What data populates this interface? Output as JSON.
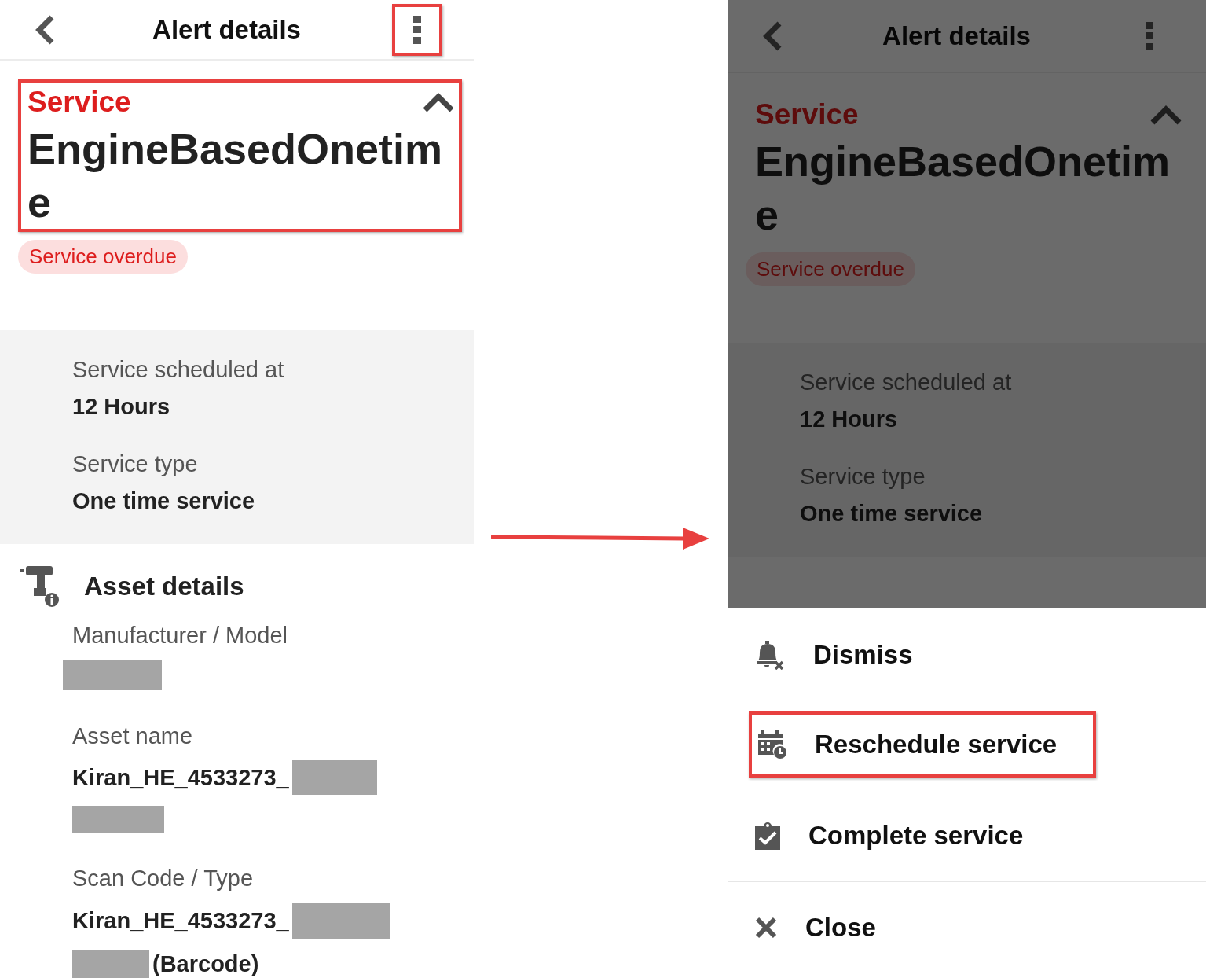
{
  "screens": [
    {
      "dimmed": false,
      "header": {
        "title": "Alert details",
        "menu_highlighted": true
      },
      "alert": {
        "highlighted": true,
        "category": "Service",
        "name": "EngineBasedOnetime",
        "badge": "Service overdue"
      },
      "details": [
        {
          "label": "Service scheduled at",
          "value": "12 Hours"
        },
        {
          "label": "Service type",
          "value": "One time service"
        }
      ],
      "asset": {
        "title": "Asset details",
        "fields": [
          {
            "label": "Manufacturer / Model",
            "redacted": true
          },
          {
            "label": "Asset name",
            "value": "Kiran_HE_4533273_",
            "redacted": true
          },
          {
            "label": "Scan Code / Type",
            "value": "Kiran_HE_4533273_",
            "redacted": true,
            "suffix": "(Barcode)"
          }
        ]
      }
    },
    {
      "dimmed": true,
      "header": {
        "title": "Alert details",
        "menu_highlighted": false
      },
      "alert": {
        "highlighted": false,
        "category": "Service",
        "name": "EngineBasedOnetime",
        "badge": "Service overdue"
      },
      "details": [
        {
          "label": "Service scheduled at",
          "value": "12 Hours"
        },
        {
          "label": "Service type",
          "value": "One time service"
        }
      ]
    }
  ],
  "action_sheet": {
    "items": [
      {
        "kind": "dismiss",
        "label": "Dismiss",
        "highlighted": false
      },
      {
        "kind": "reschedule",
        "label": "Reschedule service",
        "highlighted": true
      },
      {
        "kind": "complete",
        "label": "Complete service",
        "highlighted": false
      },
      {
        "kind": "close",
        "label": "Close",
        "highlighted": false
      }
    ]
  }
}
